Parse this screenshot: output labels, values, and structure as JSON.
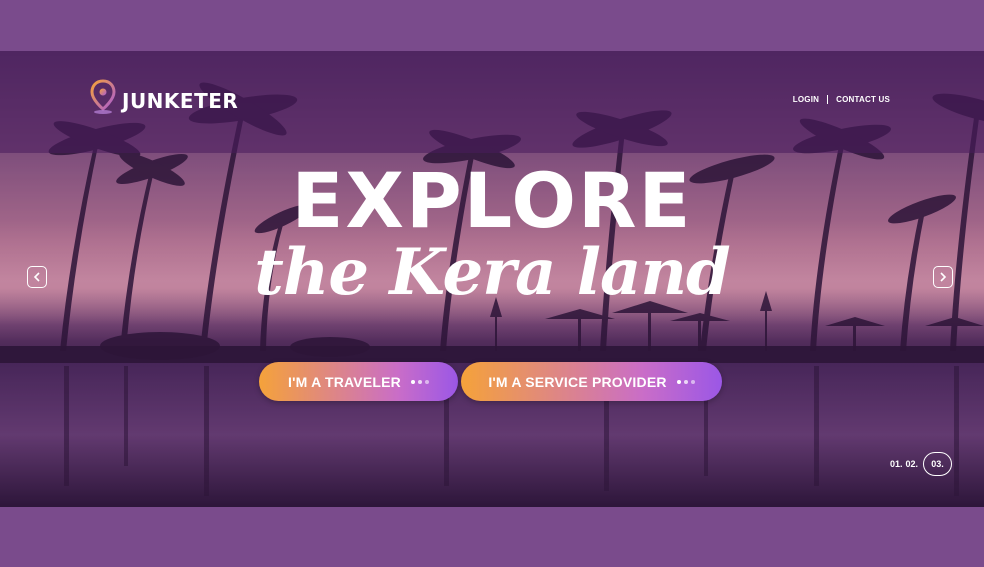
{
  "brand": {
    "name": "JUNKETER",
    "icon": "map-pin-icon",
    "pin_color": "#e79a3c"
  },
  "nav": {
    "login": "LOGIN",
    "contact": "CONTACT US"
  },
  "hero": {
    "headline": "EXPLORE",
    "subline": "the Kera land"
  },
  "cta": {
    "traveler": "I'M A TRAVELER",
    "provider": "I'M A SERVICE PROVIDER"
  },
  "slider": {
    "pages": [
      "01.",
      "02.",
      "03."
    ],
    "active_index": 2,
    "prev_icon": "chevron-left-icon",
    "next_icon": "chevron-right-icon"
  },
  "colors": {
    "frame": "#7a4b8c",
    "cta_start": "#f5a23a",
    "cta_end": "#9b57e6"
  }
}
